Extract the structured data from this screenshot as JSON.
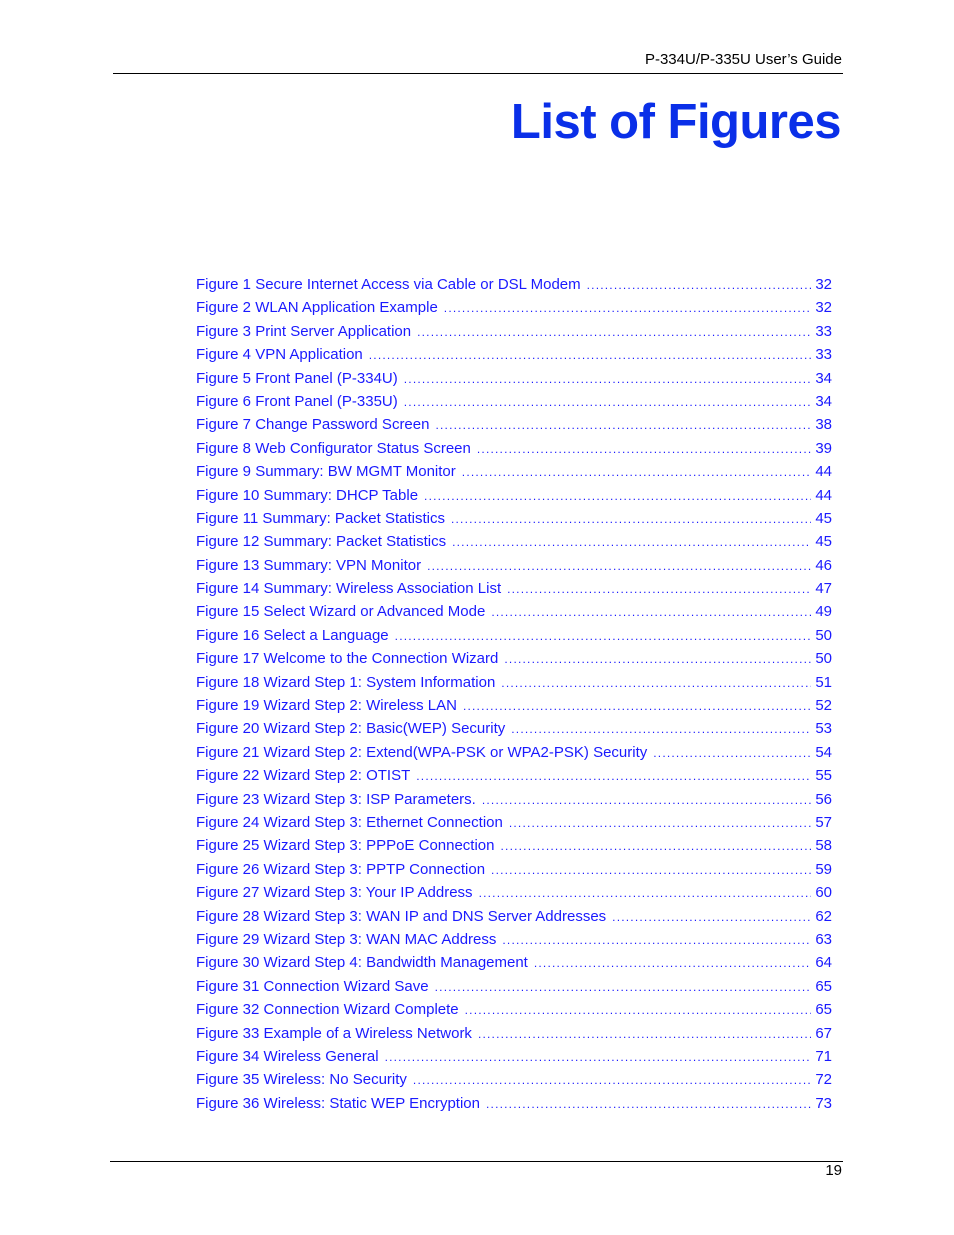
{
  "header": {
    "guide_title": "P-334U/P-335U User’s Guide"
  },
  "page_title": "List of Figures",
  "accent_color": "#0a2fe8",
  "link_color": "#1a1aff",
  "figures": [
    {
      "label": "Figure 1 Secure Internet Access via Cable or DSL Modem",
      "page": "32"
    },
    {
      "label": "Figure 2 WLAN Application Example",
      "page": "32"
    },
    {
      "label": "Figure 3 Print Server Application",
      "page": "33"
    },
    {
      "label": "Figure 4 VPN Application",
      "page": "33"
    },
    {
      "label": "Figure 5 Front Panel (P-334U)",
      "page": "34"
    },
    {
      "label": "Figure 6 Front Panel (P-335U)",
      "page": "34"
    },
    {
      "label": "Figure 7 Change Password Screen",
      "page": "38"
    },
    {
      "label": "Figure 8 Web Configurator Status Screen",
      "page": "39"
    },
    {
      "label": "Figure 9 Summary: BW MGMT Monitor",
      "page": "44"
    },
    {
      "label": "Figure 10 Summary: DHCP Table",
      "page": "44"
    },
    {
      "label": "Figure 11 Summary: Packet Statistics",
      "page": "45"
    },
    {
      "label": "Figure 12 Summary: Packet Statistics",
      "page": "45"
    },
    {
      "label": "Figure 13 Summary: VPN Monitor",
      "page": "46"
    },
    {
      "label": "Figure 14 Summary: Wireless Association List",
      "page": "47"
    },
    {
      "label": "Figure 15 Select Wizard or Advanced Mode",
      "page": "49"
    },
    {
      "label": "Figure 16 Select a Language",
      "page": "50"
    },
    {
      "label": "Figure 17 Welcome to the Connection Wizard",
      "page": "50"
    },
    {
      "label": "Figure 18 Wizard Step 1: System Information",
      "page": "51"
    },
    {
      "label": "Figure 19 Wizard Step 2: Wireless LAN",
      "page": "52"
    },
    {
      "label": "Figure 20 Wizard Step 2: Basic(WEP) Security",
      "page": "53"
    },
    {
      "label": "Figure 21 Wizard Step 2: Extend(WPA-PSK or WPA2-PSK) Security",
      "page": "54"
    },
    {
      "label": "Figure 22 Wizard Step 2: OTIST",
      "page": "55"
    },
    {
      "label": "Figure 23 Wizard Step 3: ISP Parameters.",
      "page": "56"
    },
    {
      "label": "Figure 24 Wizard Step 3: Ethernet Connection",
      "page": "57"
    },
    {
      "label": "Figure 25 Wizard Step 3: PPPoE Connection",
      "page": "58"
    },
    {
      "label": "Figure 26 Wizard Step 3: PPTP Connection",
      "page": "59"
    },
    {
      "label": "Figure 27 Wizard Step 3: Your IP Address",
      "page": "60"
    },
    {
      "label": "Figure 28 Wizard Step 3: WAN IP and DNS Server Addresses",
      "page": "62"
    },
    {
      "label": "Figure 29 Wizard Step 3: WAN MAC Address",
      "page": "63"
    },
    {
      "label": "Figure 30 Wizard Step 4: Bandwidth Management",
      "page": "64"
    },
    {
      "label": "Figure 31 Connection Wizard Save",
      "page": "65"
    },
    {
      "label": "Figure 32 Connection Wizard Complete",
      "page": "65"
    },
    {
      "label": "Figure 33 Example of a Wireless Network",
      "page": "67"
    },
    {
      "label": "Figure 34 Wireless General",
      "page": "71"
    },
    {
      "label": "Figure 35 Wireless: No Security",
      "page": "72"
    },
    {
      "label": "Figure 36 Wireless: Static WEP Encryption",
      "page": "73"
    }
  ],
  "footer": {
    "page_number": "19"
  }
}
